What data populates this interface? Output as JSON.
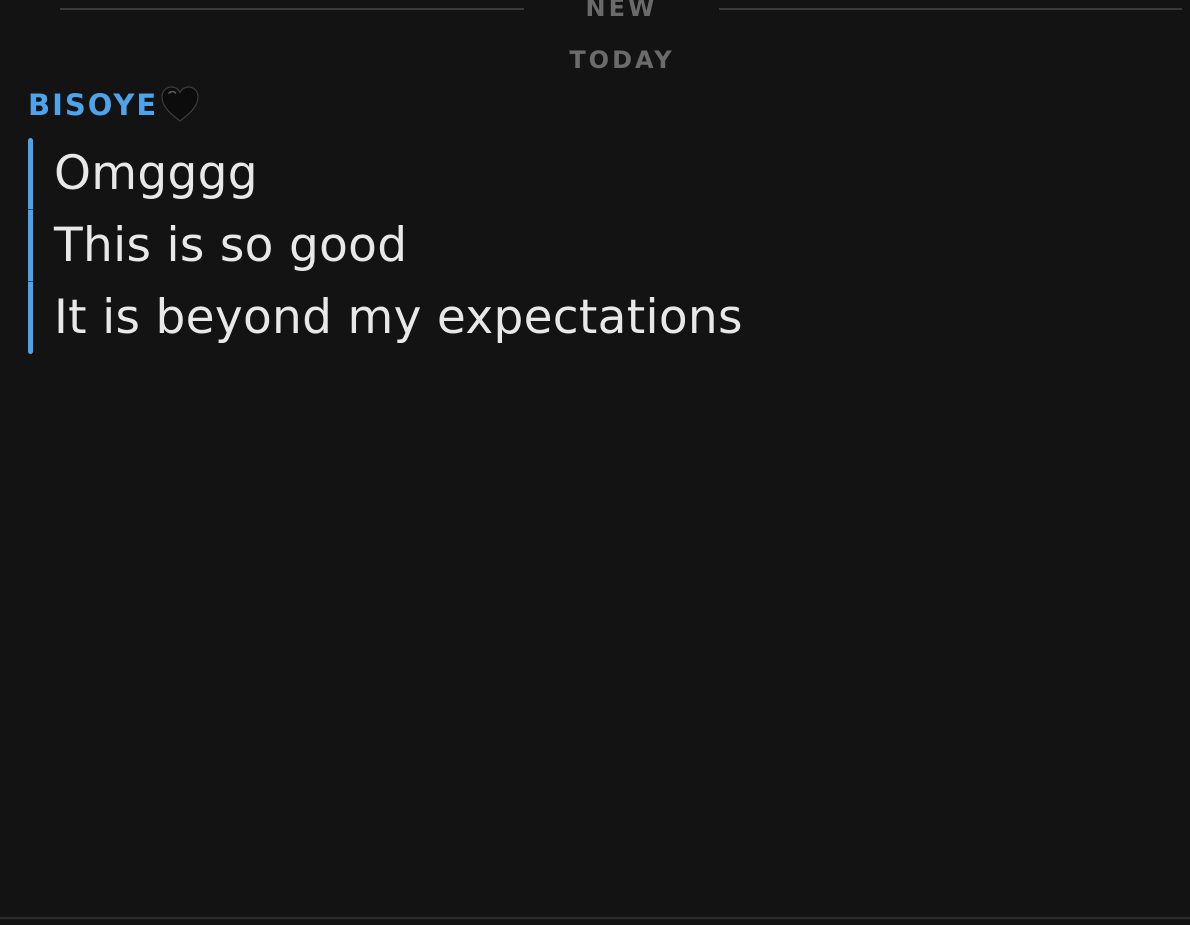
{
  "divider": {
    "new_label": "NEW"
  },
  "date_header": "TODAY",
  "sender": {
    "name": "BISOYE",
    "emoji_icon": "black-heart-icon",
    "name_color": "#4ea3ea"
  },
  "messages": [
    {
      "text": "Omgggg"
    },
    {
      "text": "This is so good"
    },
    {
      "text": "It is beyond my expectations"
    }
  ],
  "colors": {
    "background": "#131313",
    "accent": "#4ea3ea",
    "muted_label": "#6b6b6b",
    "message_text": "#e8e8e8"
  }
}
